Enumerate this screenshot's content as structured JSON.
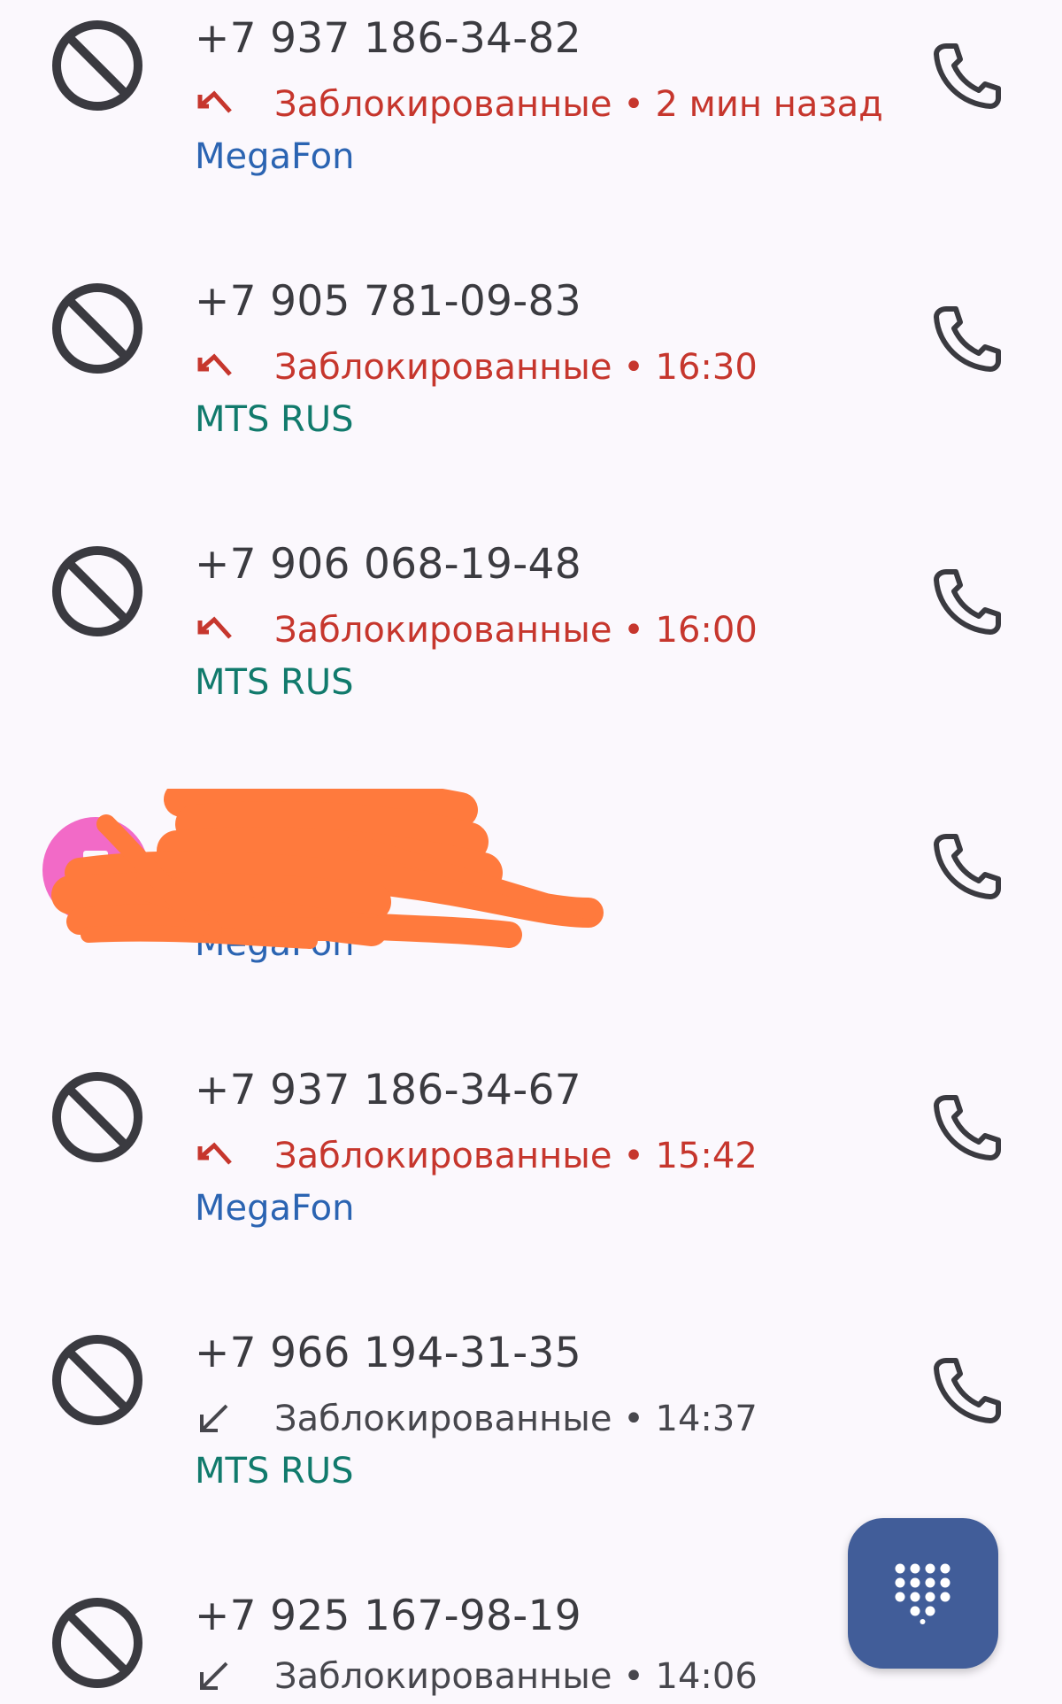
{
  "calls": [
    {
      "number": "+7 937 186-34-82",
      "status": "Заблокированные",
      "separator": "•",
      "time": "2 мин назад",
      "carrier": "MegaFon",
      "direction": "missed"
    },
    {
      "number": "+7 905 781-09-83",
      "status": "Заблокированные",
      "separator": "•",
      "time": "16:30",
      "carrier": "MTS RUS",
      "direction": "missed"
    },
    {
      "number": "+7 906 068-19-48",
      "status": "Заблокированные",
      "separator": "•",
      "time": "16:00",
      "carrier": "MTS RUS",
      "direction": "missed"
    },
    {
      "carrier": "MegaFon",
      "redacted": true
    },
    {
      "number": "+7 937 186-34-67",
      "status": "Заблокированные",
      "separator": "•",
      "time": "15:42",
      "carrier": "MegaFon",
      "direction": "missed"
    },
    {
      "number": "+7 966 194-31-35",
      "status": "Заблокированные",
      "separator": "•",
      "time": "14:37",
      "carrier": "MTS RUS",
      "direction": "incoming"
    },
    {
      "number": "+7 925 167-98-19",
      "status": "Заблокированные",
      "separator": "•",
      "time": "14:06",
      "direction": "incoming"
    }
  ],
  "icons": {
    "blocked": "block-icon",
    "call": "phone-icon",
    "missed": "missed-call-arrow-icon",
    "incoming": "incoming-call-arrow-icon",
    "dialpad": "dialpad-icon"
  },
  "colors": {
    "missed_red": "#c6362d",
    "megafon_blue": "#2b64b2",
    "mts_teal": "#117a6c",
    "fab_blue": "#415d99",
    "redaction_orange": "#ff7a3d",
    "avatar_pink": "#f26ac7"
  }
}
